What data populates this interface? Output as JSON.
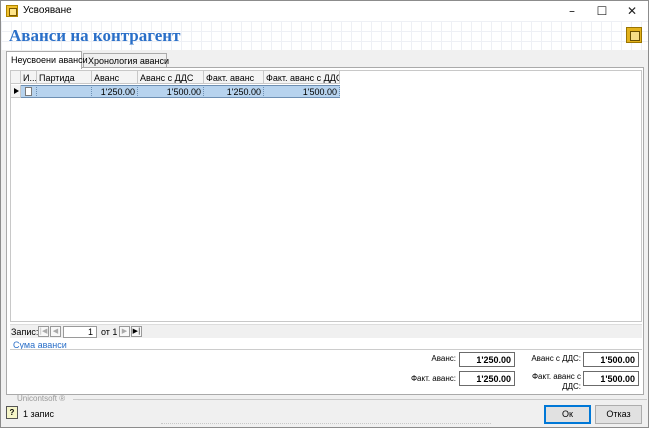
{
  "window": {
    "title": "Усвояване"
  },
  "header": {
    "title": "Аванси на контрагент"
  },
  "tabs": [
    {
      "label": "Неусвоени аванси"
    },
    {
      "label": "Хронология аванси"
    }
  ],
  "grid": {
    "columns": [
      "И...",
      "Партида",
      "Аванс",
      "Аванс с ДДС",
      "Факт. аванс",
      "Факт. аванс с ДДС"
    ],
    "rows": [
      {
        "partida": "",
        "avans": "1'250.00",
        "avans_vat": "1'500.00",
        "fact_avans": "1'250.00",
        "fact_avans_vat": "1'500.00"
      }
    ]
  },
  "navigator": {
    "label": "Запис:",
    "position": "1",
    "of_text": "от 1"
  },
  "summary_link": "Сума аванси",
  "totals": {
    "avans_label": "Аванс:",
    "avans_value": "1'250.00",
    "avans_vat_label": "Аванс с ДДС:",
    "avans_vat_value": "1'500.00",
    "fact_label": "Факт. аванс:",
    "fact_value": "1'250.00",
    "fact_vat_label": "Факт. аванс с ДДС:",
    "fact_vat_value": "1'500.00"
  },
  "footer": {
    "brand": "Unicontsoft ®",
    "help": "?",
    "status": "1 запис",
    "ok_label": "Ок",
    "cancel_label": "Отказ"
  }
}
